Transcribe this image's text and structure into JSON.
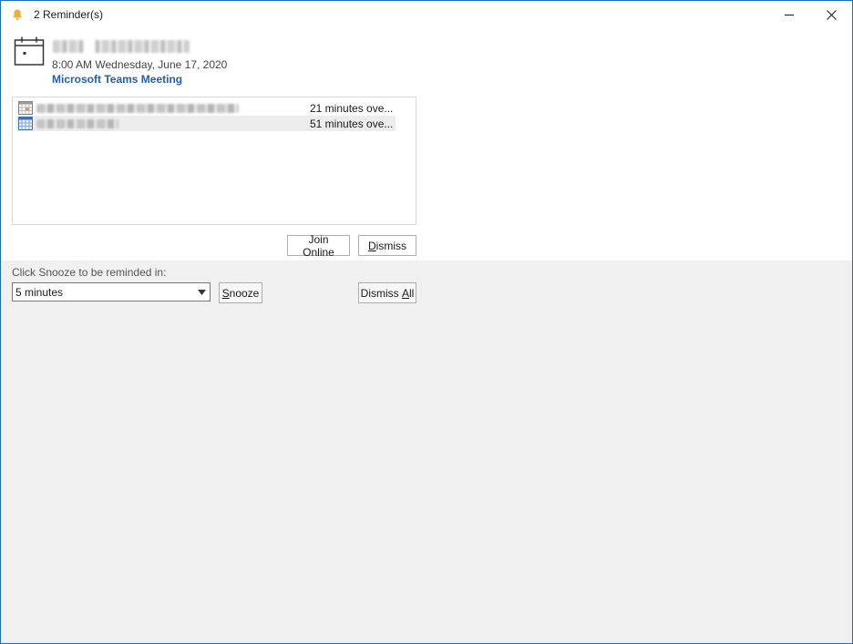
{
  "window": {
    "title": "2 Reminder(s)",
    "icons": {
      "app": "bell-icon",
      "minimize": "minimize-icon",
      "close": "close-icon"
    },
    "accent_color": "#1b6fc2"
  },
  "header": {
    "icon": "calendar-icon",
    "when": "8:00 AM Wednesday, June 17, 2020",
    "location": "Microsoft Teams Meeting",
    "location_color": "#1f5fae"
  },
  "reminders": [
    {
      "icon": "appointment-icon",
      "due": "21 minutes ove..."
    },
    {
      "icon": "appointment-icon",
      "due": "51 minutes ove...",
      "selected": true
    }
  ],
  "actions": {
    "join_online": "Join Online",
    "dismiss_prefix": "",
    "dismiss_u": "D",
    "dismiss_rest": "ismiss"
  },
  "snooze": {
    "label": "Click Snooze to be reminded in:",
    "selected_option": "5 minutes",
    "snooze_u": "S",
    "snooze_rest": "nooze",
    "dismiss_all_prefix": "Dismiss ",
    "dismiss_all_u": "A",
    "dismiss_all_rest": "ll"
  }
}
